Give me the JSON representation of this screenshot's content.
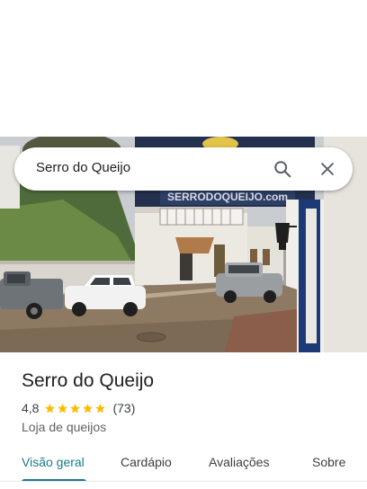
{
  "search": {
    "query": "Serro do Queijo"
  },
  "place": {
    "name": "Serro do Queijo",
    "rating": "4,8",
    "stars": 5,
    "review_count": "(73)",
    "category": "Loja de queijos"
  },
  "tabs": [
    {
      "label": "Visão geral",
      "active": true
    },
    {
      "label": "Cardápio",
      "active": false
    },
    {
      "label": "Avaliações",
      "active": false
    },
    {
      "label": "Sobre",
      "active": false
    }
  ],
  "photo": {
    "sign_text": "SERRODOQUEIJO.com"
  },
  "colors": {
    "accent": "#1a7a8a",
    "star": "#fbbc04",
    "text": "#202124",
    "muted": "#5f6368"
  },
  "icons": [
    "search-icon",
    "close-icon",
    "star-icon",
    "street-lamp-icon"
  ]
}
